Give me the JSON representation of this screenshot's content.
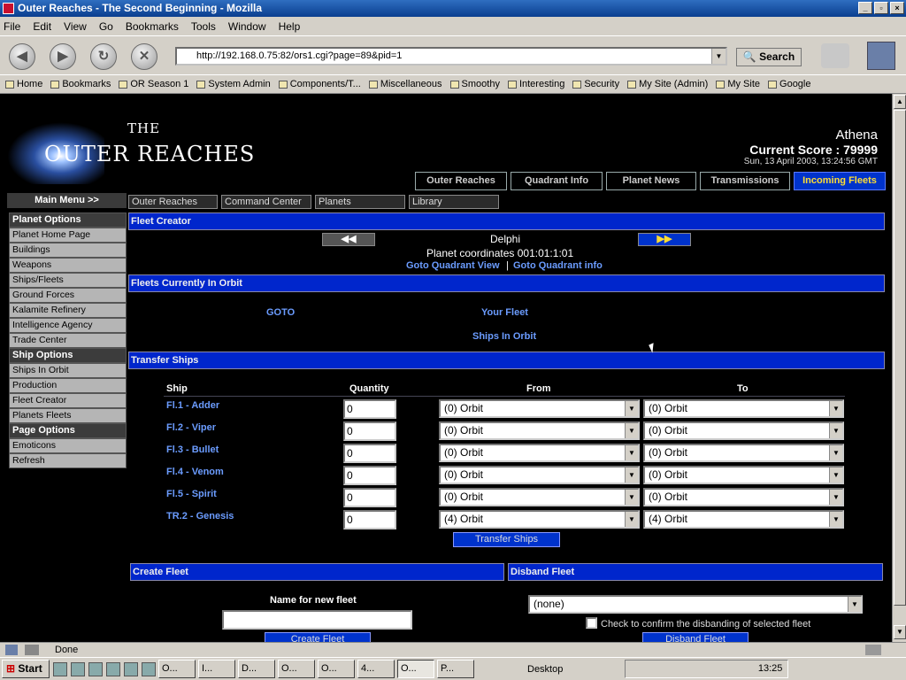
{
  "window": {
    "title": "Outer Reaches - The Second Beginning - Mozilla",
    "menu": [
      "File",
      "Edit",
      "View",
      "Go",
      "Bookmarks",
      "Tools",
      "Window",
      "Help"
    ],
    "url": "http://192.168.0.75:82/ors1.cgi?page=89&pid=1",
    "search_label": "Search",
    "bookmarks": [
      "Home",
      "Bookmarks",
      "OR Season 1",
      "System Admin",
      "Components/T...",
      "Miscellaneous",
      "Smoothy",
      "Interesting",
      "Security",
      "My Site (Admin)",
      "My Site",
      "Google"
    ]
  },
  "site": {
    "logo_the": "THE",
    "logo_name": "OUTER REACHES",
    "user": "Athena",
    "score": "Current Score : 79999",
    "datetime": "Sun, 13 April 2003, 13:24:56 GMT",
    "tabs": [
      "Outer Reaches",
      "Quadrant Info",
      "Planet News",
      "Transmissions",
      "Incoming Fleets"
    ],
    "main_menu": "Main Menu >>",
    "subnav": [
      "Outer Reaches",
      "Command Center",
      "Planets",
      "Library"
    ]
  },
  "sidebar": {
    "planet_options": "Planet Options",
    "planet_items": [
      "Planet Home Page",
      "Buildings",
      "Weapons",
      "Ships/Fleets",
      "Ground Forces",
      "Kalamite Refinery",
      "Intelligence Agency",
      "Trade Center"
    ],
    "ship_options": "Ship Options",
    "ship_items": [
      "Ships In Orbit",
      "Production",
      "Fleet Creator",
      "Planets Fleets"
    ],
    "page_options": "Page Options",
    "page_items": [
      "Emoticons",
      "Refresh"
    ]
  },
  "main": {
    "fleet_creator": "Fleet Creator",
    "planet_name": "Delphi",
    "planet_coords": "Planet coordinates 001:01:1:01",
    "goto_quadrant_view": "Goto Quadrant View",
    "goto_quadrant_info": "Goto Quadrant info",
    "separator": "|",
    "fleets_in_orbit": "Fleets Currently In Orbit",
    "goto": "GOTO",
    "your_fleet": "Your Fleet",
    "ships_in_orbit": "Ships In Orbit",
    "transfer_ships": "Transfer Ships",
    "col_ship": "Ship",
    "col_quantity": "Quantity",
    "col_from": "From",
    "col_to": "To",
    "ships": [
      {
        "name": "Fl.1 - Adder",
        "qty": "0",
        "from": "(0) Orbit",
        "to": "(0) Orbit"
      },
      {
        "name": "Fl.2 - Viper",
        "qty": "0",
        "from": "(0) Orbit",
        "to": "(0) Orbit"
      },
      {
        "name": "Fl.3 - Bullet",
        "qty": "0",
        "from": "(0) Orbit",
        "to": "(0) Orbit"
      },
      {
        "name": "Fl.4 - Venom",
        "qty": "0",
        "from": "(0) Orbit",
        "to": "(0) Orbit"
      },
      {
        "name": "Fl.5 - Spirit",
        "qty": "0",
        "from": "(0) Orbit",
        "to": "(0) Orbit"
      },
      {
        "name": "TR.2 - Genesis",
        "qty": "0",
        "from": "(4) Orbit",
        "to": "(4) Orbit"
      }
    ],
    "transfer_button": "Transfer Ships",
    "create_fleet": "Create Fleet",
    "disband_fleet": "Disband Fleet",
    "name_for_new_fleet": "Name for new fleet",
    "disband_select": "(none)",
    "disband_confirm": "Check to confirm the disbanding of selected fleet",
    "create_button": "Create Fleet",
    "disband_button": "Disband Fleet"
  },
  "status": {
    "text": "Done"
  },
  "taskbar": {
    "start": "Start",
    "tasks": [
      "O...",
      "I...",
      "D...",
      "O...",
      "O...",
      "4...",
      "O...",
      "P..."
    ],
    "desktop": "Desktop",
    "clock": "13:25"
  }
}
